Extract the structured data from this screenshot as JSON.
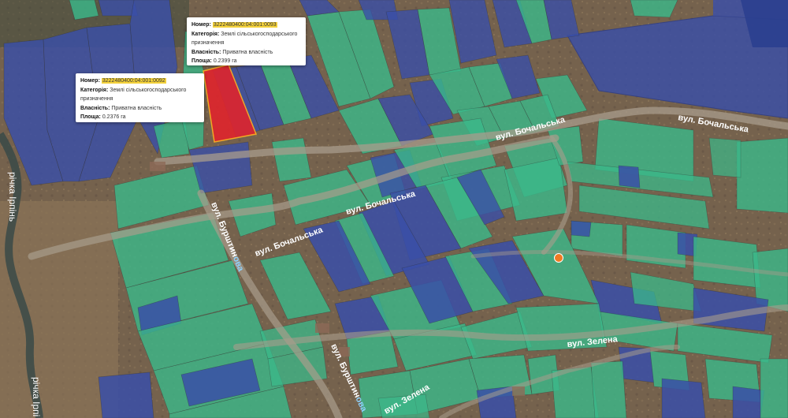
{
  "map": {
    "streets": {
      "bochalska_east": "вул. Бочальська",
      "bochalska_mid": "вул. Бочальська",
      "bochalska_west": "вул. Бочальська",
      "burshtynova_north_prefix": "вул. Бурштин",
      "burshtynova_north_highlight": "ова",
      "burshtynova_south_prefix": "вул. Бурштин",
      "burshtynova_south_highlight": "ова",
      "zelena_east": "вул. Зелена",
      "zelena_south": "вул. Зелена"
    },
    "rivers": {
      "irpin_top": "річка Ірпінь",
      "irpin_bottom": "річка Ірпі"
    }
  },
  "popups": [
    {
      "number_label": "Номер:",
      "number_value": "3222480400:04:001:0093",
      "category_label": "Категорія:",
      "category_value": "Землі сільськогосподарського призначення",
      "ownership_label": "Власність:",
      "ownership_value": "Приватна власність",
      "area_label": "Площа:",
      "area_value": "0.2399 га"
    },
    {
      "number_label": "Номер:",
      "number_value": "3222480400:04:001:0092",
      "category_label": "Категорія:",
      "category_value": "Землі сільськогосподарського призначення",
      "ownership_label": "Власність:",
      "ownership_value": "Приватна власність",
      "area_label": "Площа:",
      "area_value": "0.2376 га"
    }
  ],
  "colors": {
    "parcel_green": "#3bb98a",
    "parcel_blue": "#3a4fa8",
    "parcel_selected": "#e0242c",
    "marker": "#f07a22",
    "highlight": "#f4d23c"
  }
}
